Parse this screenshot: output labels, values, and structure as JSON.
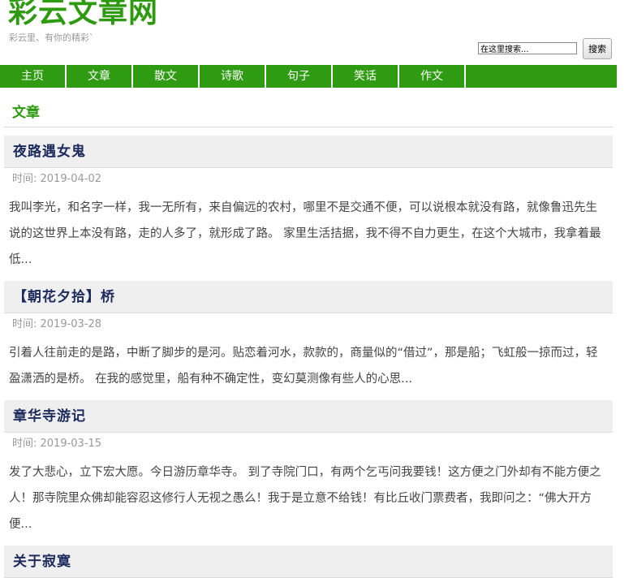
{
  "site": {
    "title": "彩云文章网",
    "slogan": "彩云里、有你的精彩`"
  },
  "search": {
    "value": "在这里搜索...",
    "button_label": "搜索"
  },
  "nav": {
    "items": [
      {
        "label": "主页"
      },
      {
        "label": "文章"
      },
      {
        "label": "散文"
      },
      {
        "label": "诗歌"
      },
      {
        "label": "句子"
      },
      {
        "label": "笑话"
      },
      {
        "label": "作文"
      }
    ]
  },
  "section": {
    "title": "文章"
  },
  "articles": [
    {
      "title": "夜路遇女鬼",
      "date": "时间: 2019-04-02",
      "excerpt": "我叫李光，和名字一样，我一无所有，来自偏远的农村，哪里不是交通不便，可以说根本就没有路，就像鲁迅先生说的这世界上本没有路，走的人多了，就形成了路。 家里生活拮据，我不得不自力更生，在这个大城市，我拿着最低..."
    },
    {
      "title": "【朝花夕拾】桥",
      "date": "时间: 2019-03-28",
      "excerpt": "引着人往前走的是路，中断了脚步的是河。贴恋着河水，款款的，商量似的“借过”，那是船；飞虹般一掠而过，轻盈潇洒的是桥。 在我的感觉里，船有种不确定性，变幻莫测像有些人的心思..."
    },
    {
      "title": "章华寺游记",
      "date": "时间: 2019-03-15",
      "excerpt": "发了大悲心，立下宏大愿。今日游历章华寺。 到了寺院门口，有两个乞丐问我要钱！这方便之门外却有不能方便之人！那寺院里众佛却能容忍这修行人无视之愚么！我于是立意不给钱！有比丘收门票费者，我即问之：“佛大开方便..."
    },
    {
      "title": "关于寂寞",
      "date": "",
      "excerpt": ""
    }
  ]
}
